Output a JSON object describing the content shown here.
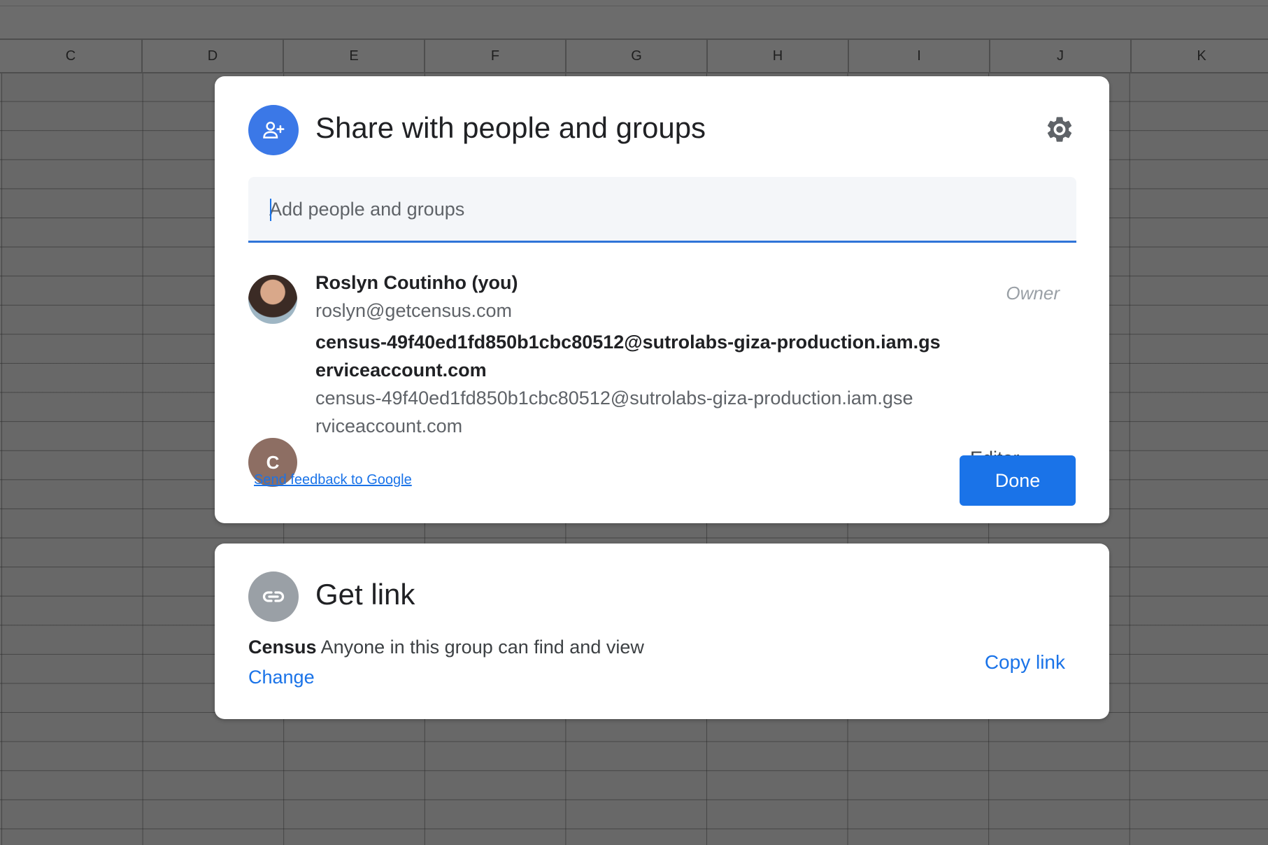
{
  "spreadsheet": {
    "columns": [
      "C",
      "D",
      "E",
      "F",
      "G",
      "H",
      "I",
      "J",
      "K"
    ]
  },
  "share_dialog": {
    "title": "Share with people and groups",
    "head_icon": "person-add-icon",
    "settings_icon": "gear-icon",
    "add_people_placeholder": "Add people and groups",
    "add_people_value": "",
    "people": [
      {
        "name": "Roslyn Coutinho (you)",
        "email": "roslyn@getcensus.com",
        "role": "Owner",
        "avatar": "profile-photo"
      },
      {
        "name_line1": "census-49f40ed1fd850b1cbc80512@sutrolabs-giza-production.iam.gs",
        "name_line2": "erviceaccount.com",
        "email_line1": "census-49f40ed1fd850b1cbc80512@sutrolabs-giza-production.iam.gse",
        "email_line2": "rviceaccount.com",
        "role": "Editor",
        "avatar_letter": "C"
      }
    ],
    "feedback_link": "Send feedback to Google",
    "done_label": "Done",
    "accent_color": "#1a73e8"
  },
  "link_dialog": {
    "title": "Get link",
    "head_icon": "link-icon",
    "group_name": "Census",
    "access_text": "Anyone in this group can find and view",
    "change_label": "Change",
    "copy_label": "Copy link"
  }
}
